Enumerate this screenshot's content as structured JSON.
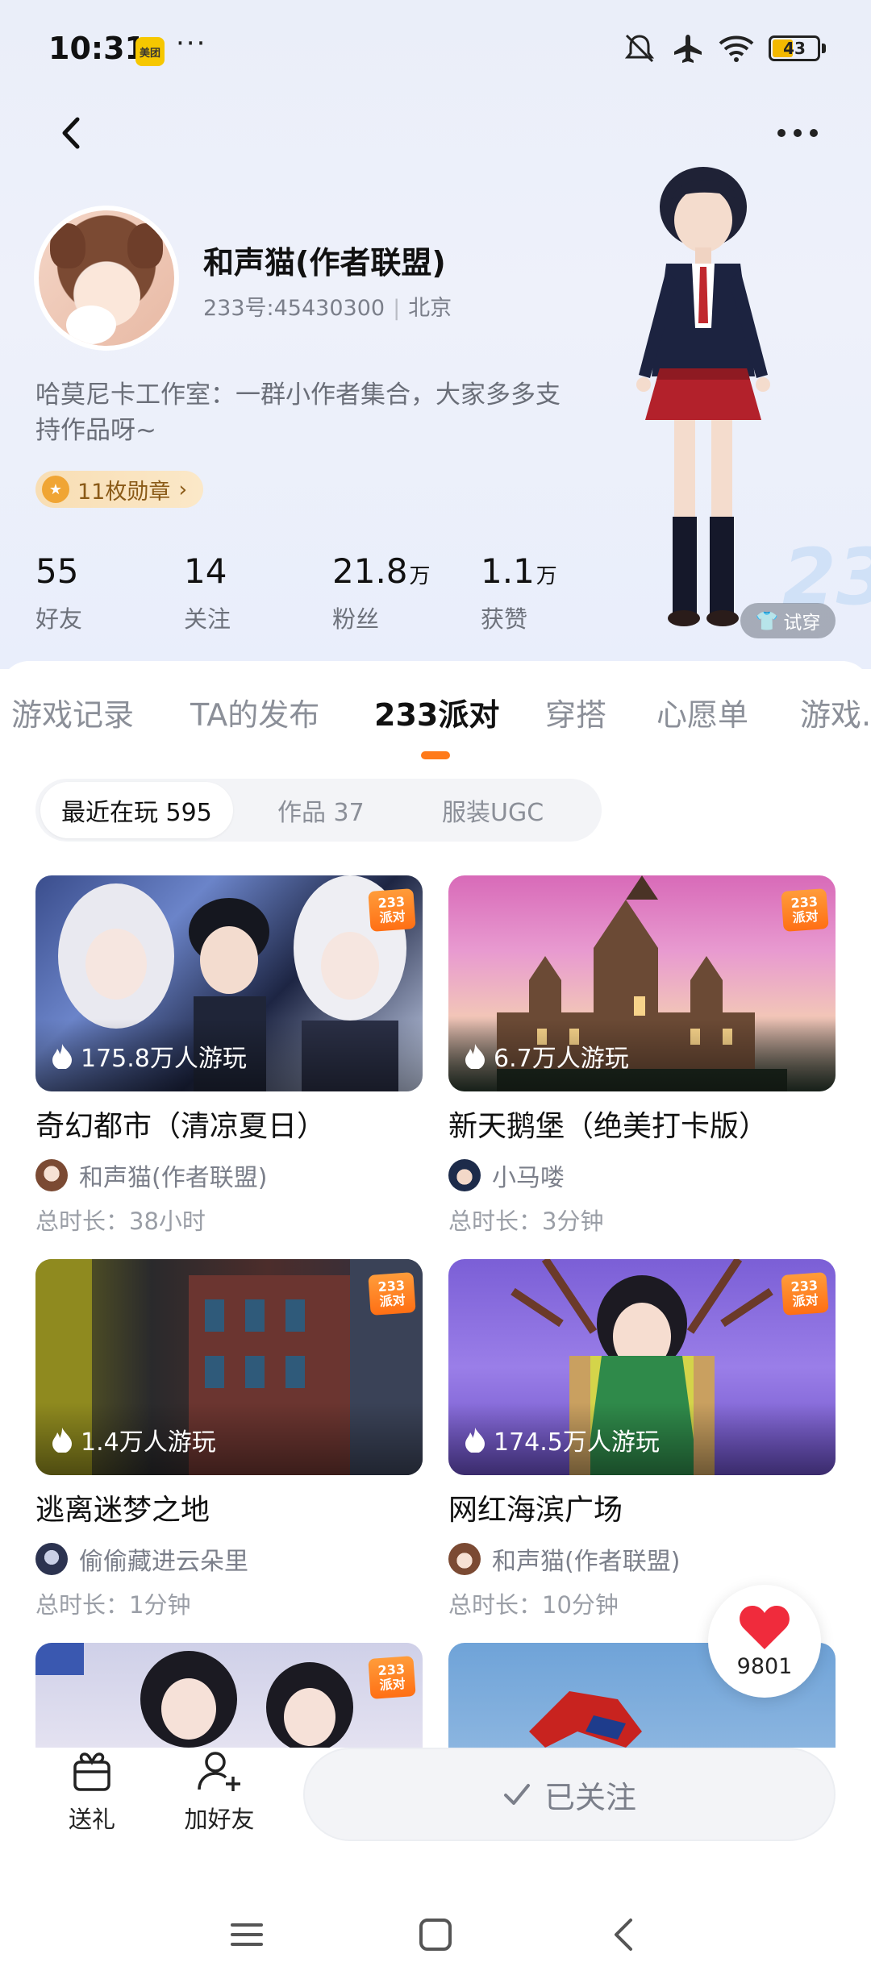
{
  "status_bar": {
    "time": "10:31",
    "app_badge": "美团",
    "dots": "···",
    "battery": "43"
  },
  "profile": {
    "name": "和声猫(作者联盟)",
    "id_label": "233号:45430300",
    "location": "北京",
    "bio": "哈莫尼卡工作室：一群小作者集合，大家多多支持作品呀~",
    "medal_label": "11枚勋章",
    "try_on_label": "试穿",
    "stats": [
      {
        "num": "55",
        "unit": "",
        "label": "好友"
      },
      {
        "num": "14",
        "unit": "",
        "label": "关注"
      },
      {
        "num": "21.8",
        "unit": "万",
        "label": "粉丝"
      },
      {
        "num": "1.1",
        "unit": "万",
        "label": "获赞"
      }
    ]
  },
  "tabs": [
    "游戏记录",
    "TA的发布",
    "233派对",
    "穿搭",
    "心愿单",
    "游戏..."
  ],
  "active_tab": "233派对",
  "subtabs": [
    "最近在玩 595",
    "作品 37",
    "服装UGC"
  ],
  "tag_233": {
    "line1": "233",
    "line2": "派对"
  },
  "games": [
    {
      "title": "奇幻都市（清凉夏日）",
      "plays": "175.8万人游玩",
      "author": "和声猫(作者联盟)",
      "duration": "总时长：38小时"
    },
    {
      "title": "新天鹅堡（绝美打卡版）",
      "plays": "6.7万人游玩",
      "author": "小马喽",
      "duration": "总时长：3分钟"
    },
    {
      "title": "逃离迷梦之地",
      "plays": "1.4万人游玩",
      "author": "偷偷藏进云朵里",
      "duration": "总时长：1分钟"
    },
    {
      "title": "网红海滨广场",
      "plays": "174.5万人游玩",
      "author": "和声猫(作者联盟)",
      "duration": "总时长：10分钟"
    }
  ],
  "like_count": "9801",
  "actions": {
    "gift": "送礼",
    "add_friend": "加好友",
    "followed": "已关注"
  }
}
